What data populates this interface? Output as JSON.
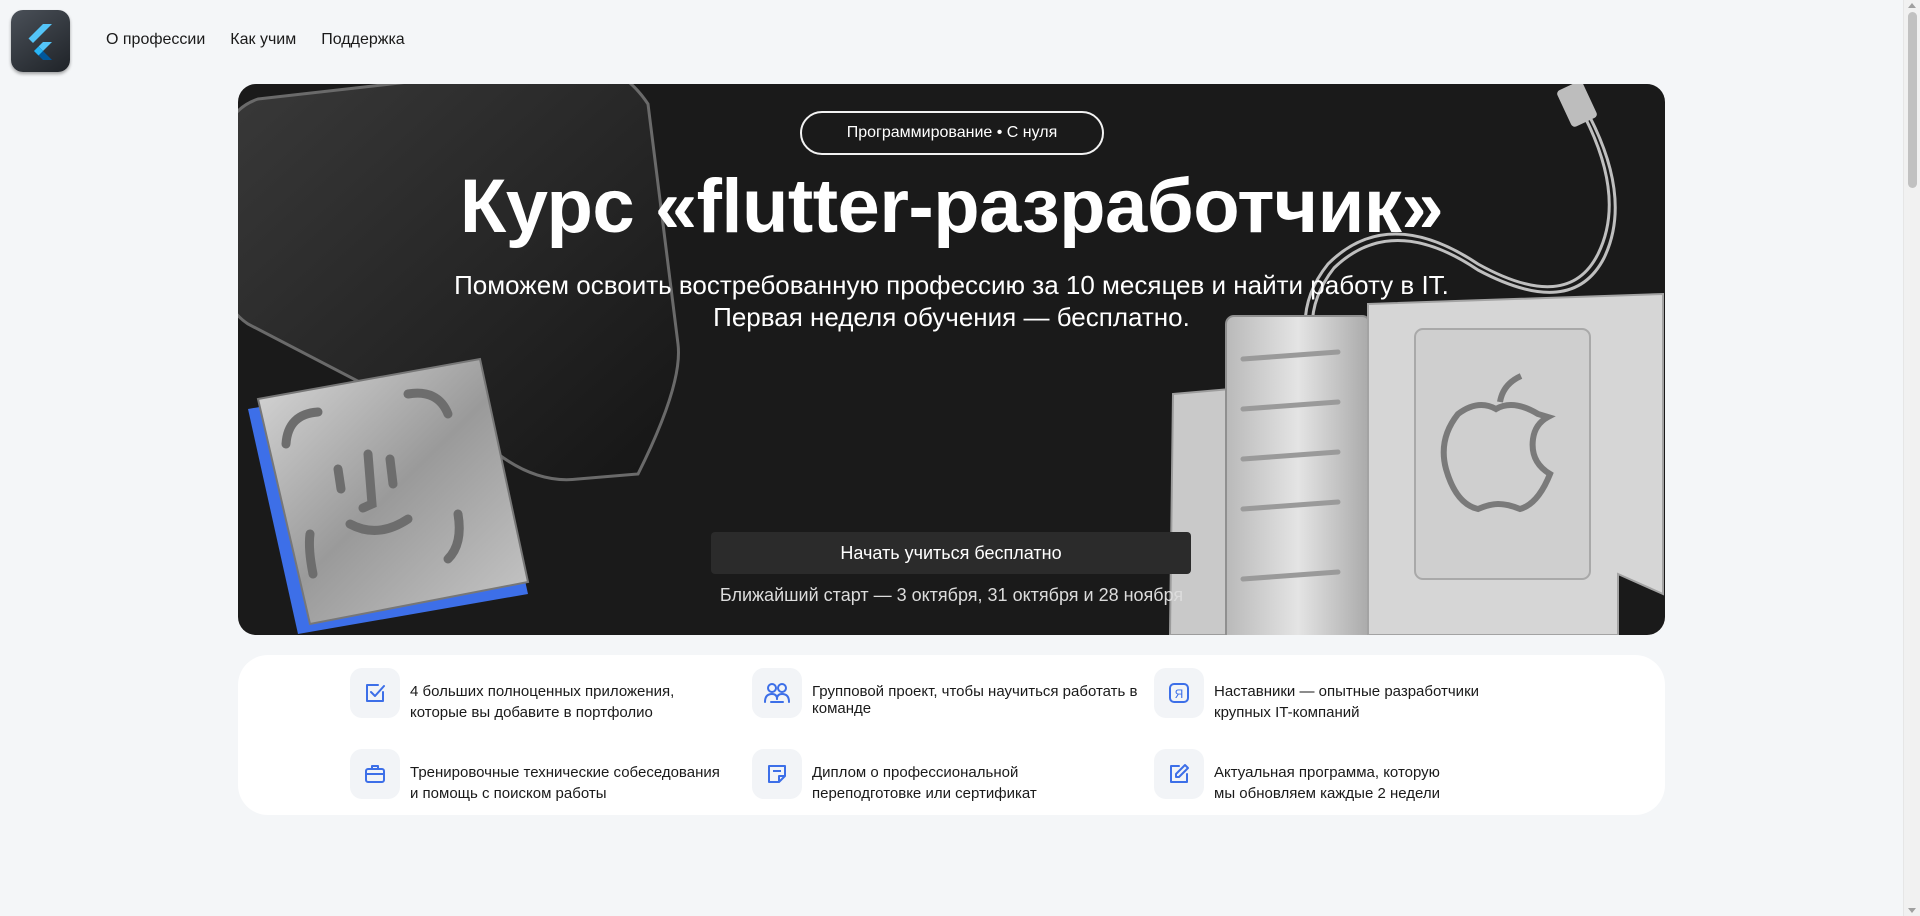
{
  "nav": {
    "items": [
      "О профессии",
      "Как учим",
      "Поддержка"
    ]
  },
  "hero": {
    "badge": "Программирование • С нуля",
    "title": "Курс «flutter-разработчик»",
    "subtitle_line1": "Поможем освоить востребованную профессию за 10 месяцев и найти работу в IT.",
    "subtitle_line2": "Первая неделя обучения — бесплатно.",
    "cta": "Начать учиться бесплатно",
    "next_start": "Ближайший старт — 3 октября, 31 октября и 28 ноября"
  },
  "features": [
    {
      "icon": "checkbox-icon",
      "line1": "4 больших полноценных приложения,",
      "line2": "которые вы добавите в портфолио"
    },
    {
      "icon": "group-icon",
      "line1": "Групповой проект, чтобы научиться работать в",
      "line2": "команде"
    },
    {
      "icon": "ya-badge-icon",
      "line1": "Наставники — опытные разработчики",
      "line2": "крупных IT-компаний"
    },
    {
      "icon": "briefcase-icon",
      "line1": "Тренировочные технические собеседования",
      "line2": "и помощь с поиском работы"
    },
    {
      "icon": "diploma-icon",
      "line1": "Диплом о профессиональной",
      "line2": "переподготовке или сертификат"
    },
    {
      "icon": "edit-icon",
      "line1": "Актуальная программа, которую",
      "line2": "мы обновляем каждые 2 недели"
    }
  ],
  "colors": {
    "accent": "#3d6fe8",
    "hero_bg": "#1a1a1a",
    "page_bg": "#f4f6f8"
  }
}
